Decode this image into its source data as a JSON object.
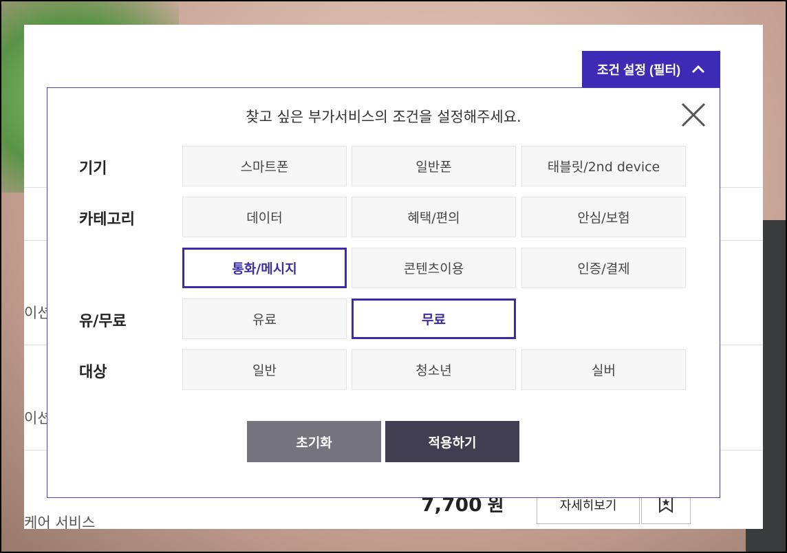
{
  "header": {
    "filter_toggle_label": "조건 설정 (필터)"
  },
  "background_list": {
    "row1_text": "이션",
    "row2_text": "이션",
    "row3_text": "케어 서비스",
    "price_value": "7,700",
    "price_unit": "원",
    "detail_button_label": "자세히보기"
  },
  "modal": {
    "title": "찾고 싶은 부가서비스의 조건을 설정해주세요.",
    "sections": {
      "device": {
        "label": "기기",
        "options": [
          "스마트폰",
          "일반폰",
          "태블릿/2nd device"
        ]
      },
      "category": {
        "label": "카테고리",
        "options": [
          "데이터",
          "혜택/편의",
          "안심/보험",
          "통화/메시지",
          "콘텐츠이용",
          "인증/결제"
        ],
        "selected": "통화/메시지"
      },
      "pricing": {
        "label": "유/무료",
        "options": [
          "유료",
          "무료"
        ],
        "selected": "무료"
      },
      "target": {
        "label": "대상",
        "options": [
          "일반",
          "청소년",
          "실버"
        ]
      }
    },
    "reset_label": "초기화",
    "apply_label": "적용하기"
  },
  "colors": {
    "accent": "#3d2bb5",
    "reset_bg": "#75737e",
    "apply_bg": "#413e52"
  },
  "icons": {
    "filter_toggle": "chevron-up-icon",
    "close": "close-icon",
    "bookmark": "bookmark-star-icon"
  }
}
